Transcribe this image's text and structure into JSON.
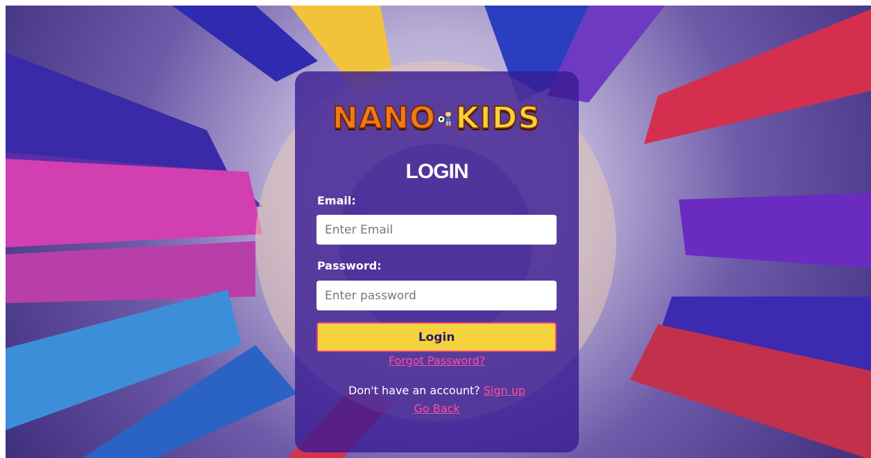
{
  "brand": {
    "logo_text_left": "NANO",
    "logo_text_right": "KIDS",
    "mascot_icon": "soccer-boy-mascot-icon"
  },
  "login": {
    "title": "LOGIN",
    "email_label": "Email:",
    "email_placeholder": "Enter Email",
    "password_label": "Password:",
    "password_placeholder": "Enter password",
    "submit_label": "Login",
    "forgot_link": "Forgot Password?",
    "signup_prompt": "Don't have an account?",
    "signup_link": "Sign up",
    "go_back_link": "Go Back"
  },
  "colors": {
    "panel": "#381c94",
    "button": "#f5d33f",
    "button_border": "#e9447f",
    "link": "#ff4f9e"
  }
}
